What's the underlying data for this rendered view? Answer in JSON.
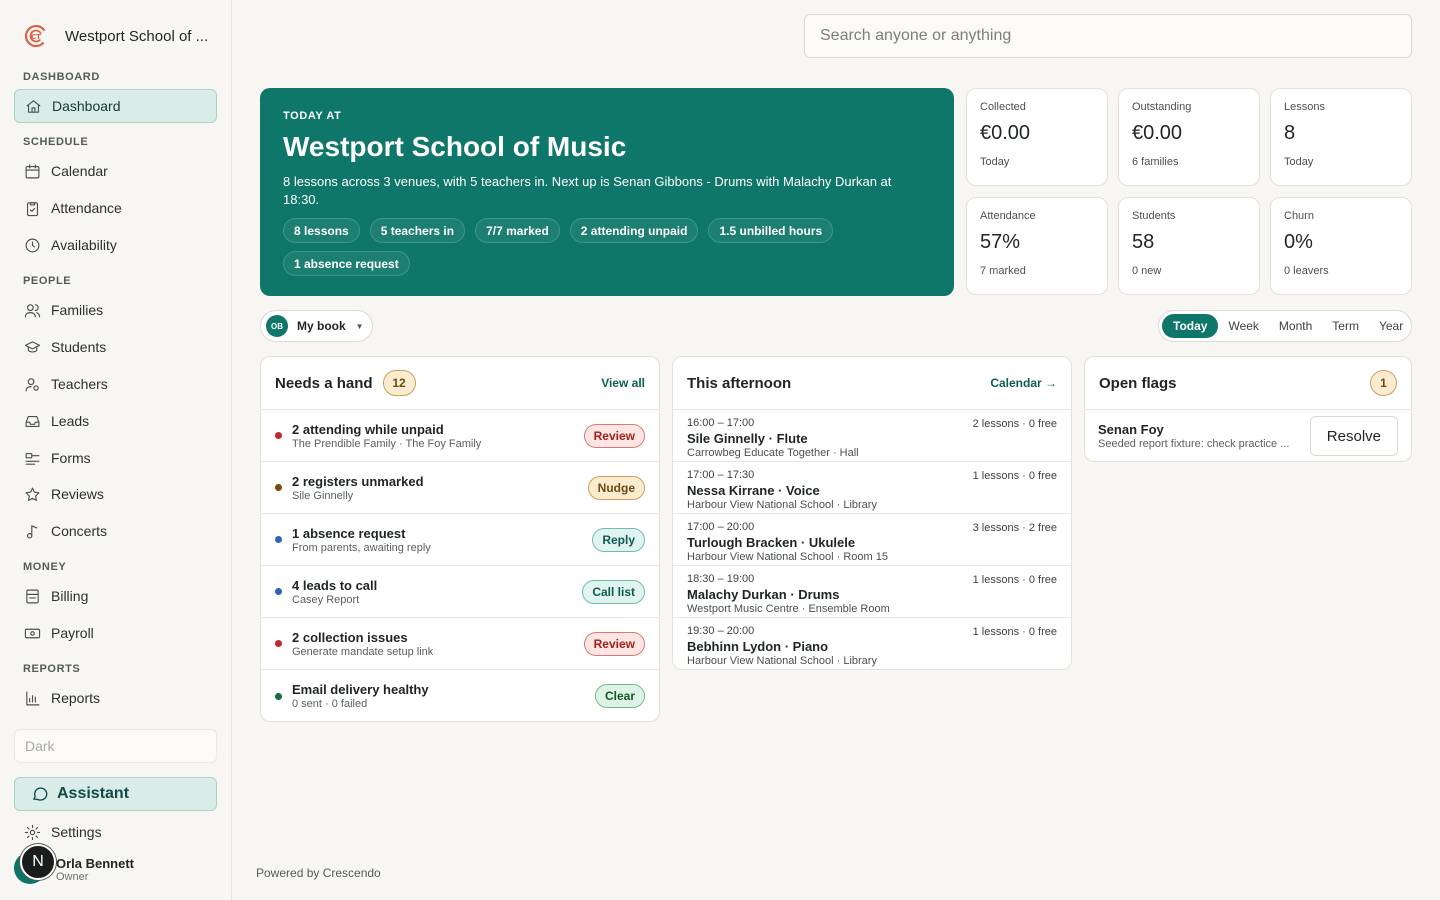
{
  "brand": {
    "name": "Westport School of ...",
    "logo_icon": "crescendo-logo-icon"
  },
  "sidebar": {
    "sections": [
      {
        "label": "DASHBOARD",
        "items": [
          {
            "label": "Dashboard",
            "icon": "home-icon",
            "active": true
          }
        ]
      },
      {
        "label": "SCHEDULE",
        "items": [
          {
            "label": "Calendar",
            "icon": "calendar-icon"
          },
          {
            "label": "Attendance",
            "icon": "clipboard-icon"
          },
          {
            "label": "Availability",
            "icon": "clock-icon"
          }
        ]
      },
      {
        "label": "PEOPLE",
        "items": [
          {
            "label": "Families",
            "icon": "users-icon"
          },
          {
            "label": "Students",
            "icon": "graduation-cap-icon"
          },
          {
            "label": "Teachers",
            "icon": "teacher-icon"
          },
          {
            "label": "Leads",
            "icon": "inbox-icon"
          },
          {
            "label": "Forms",
            "icon": "forms-icon"
          },
          {
            "label": "Reviews",
            "icon": "star-icon"
          },
          {
            "label": "Concerts",
            "icon": "music-note-icon"
          }
        ]
      },
      {
        "label": "MONEY",
        "items": [
          {
            "label": "Billing",
            "icon": "billing-icon"
          },
          {
            "label": "Payroll",
            "icon": "banknote-icon"
          }
        ]
      },
      {
        "label": "REPORTS",
        "items": [
          {
            "label": "Reports",
            "icon": "bar-chart-icon"
          }
        ]
      }
    ],
    "theme_label": "Dark",
    "assistant_label": "Assistant",
    "settings_label": "Settings",
    "user": {
      "name": "Orla Bennett",
      "role": "Owner",
      "initial": "N"
    }
  },
  "search": {
    "placeholder": "Search anyone or anything"
  },
  "hero": {
    "kicker": "TODAY AT",
    "title": "Westport School of Music",
    "description": "8 lessons across 3 venues, with 5 teachers in. Next up is Senan Gibbons - Drums with Malachy Durkan at 18:30.",
    "chips": [
      "8 lessons",
      "5 teachers in",
      "7/7 marked",
      "2 attending unpaid",
      "1.5 unbilled hours",
      "1 absence request"
    ]
  },
  "stats": [
    {
      "label": "Collected",
      "value": "€0.00",
      "sub": "Today"
    },
    {
      "label": "Outstanding",
      "value": "€0.00",
      "sub": "6 families"
    },
    {
      "label": "Lessons",
      "value": "8",
      "sub": "Today"
    },
    {
      "label": "Attendance",
      "value": "57%",
      "sub": "7 marked"
    },
    {
      "label": "Students",
      "value": "58",
      "sub": "0 new"
    },
    {
      "label": "Churn",
      "value": "0%",
      "sub": "0 leavers"
    }
  ],
  "book_select": {
    "initials": "OB",
    "label": "My book"
  },
  "range_tabs": [
    "Today",
    "Week",
    "Month",
    "Term",
    "Year"
  ],
  "range_selected": "Today",
  "needs_hand": {
    "title": "Needs a hand",
    "count": "12",
    "link": "View all",
    "rows": [
      {
        "title": "2 attending while unpaid",
        "sub": "The Prendible Family · The Foy Family",
        "action": "Review",
        "tone": "red",
        "dot": "#c0262d"
      },
      {
        "title": "2 registers unmarked",
        "sub": "Sile Ginnelly",
        "action": "Nudge",
        "tone": "amber",
        "dot": "#7a4a0c"
      },
      {
        "title": "1 absence request",
        "sub": "From parents, awaiting reply",
        "action": "Reply",
        "tone": "teal",
        "dot": "#2f63b8"
      },
      {
        "title": "4 leads to call",
        "sub": "Casey Report",
        "action": "Call list",
        "tone": "teal",
        "dot": "#2f63b8"
      },
      {
        "title": "2 collection issues",
        "sub": "Generate mandate setup link",
        "action": "Review",
        "tone": "red",
        "dot": "#c0262d"
      },
      {
        "title": "Email delivery healthy",
        "sub": "0 sent · 0 failed",
        "action": "Clear",
        "tone": "green",
        "dot": "#146c38"
      }
    ]
  },
  "afternoon": {
    "title": "This afternoon",
    "link": "Calendar →",
    "lessons": [
      {
        "time": "16:00 – 17:00",
        "name": "Sile Ginnelly · Flute",
        "venue": "Carrowbeg Educate Together · Hall",
        "meta": "2 lessons · 0 free"
      },
      {
        "time": "17:00 – 17:30",
        "name": "Nessa Kirrane · Voice",
        "venue": "Harbour View National School · Library",
        "meta": "1 lessons · 0 free"
      },
      {
        "time": "17:00 – 20:00",
        "name": "Turlough Bracken · Ukulele",
        "venue": "Harbour View National School · Room 15",
        "meta": "3 lessons · 2 free"
      },
      {
        "time": "18:30 – 19:00",
        "name": "Malachy Durkan · Drums",
        "venue": "Westport Music Centre · Ensemble Room",
        "meta": "1 lessons · 0 free"
      },
      {
        "time": "19:30 – 20:00",
        "name": "Bebhinn Lydon · Piano",
        "venue": "Harbour View National School · Library",
        "meta": "1 lessons · 0 free"
      }
    ]
  },
  "flags": {
    "title": "Open flags",
    "count": "1",
    "items": [
      {
        "name": "Senan Foy",
        "desc": "Seeded report fixture: check practice ...",
        "action": "Resolve"
      }
    ]
  },
  "footer": "Powered by Crescendo",
  "colors": {
    "accent": "#0f766a",
    "background": "#f7f6f2"
  }
}
